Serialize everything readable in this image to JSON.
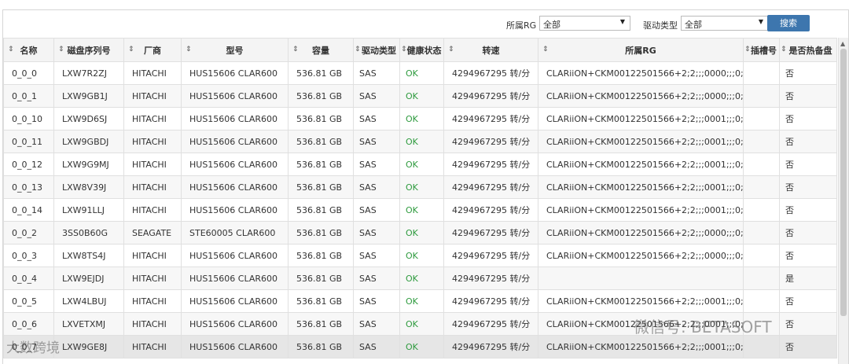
{
  "filters": {
    "rg_label": "所属RG",
    "rg_value": "全部",
    "drive_label": "驱动类型",
    "drive_value": "全部",
    "search_label": "搜索"
  },
  "icons": {
    "sort": "sort-icon",
    "dropdown": "triangle-down-icon",
    "scroll_up": "triangle-up-icon"
  },
  "colors": {
    "ok": "#2f9b3f",
    "button": "#3d76ae"
  },
  "columns": [
    "名称",
    "磁盘序列号",
    "厂商",
    "型号",
    "容量",
    "驱动类型",
    "健康状态",
    "转速",
    "所属RG",
    "插槽号",
    "是否热备盘"
  ],
  "rows": [
    {
      "name": "0_0_0",
      "serial": "LXW7R2ZJ",
      "vendor": "HITACHI",
      "model": "HUS15606 CLAR600",
      "capacity": "536.81 GB",
      "drive": "SAS",
      "health": "OK",
      "speed": "4294967295 转/分",
      "rg": "CLARiiON+CKM00122501566+2;2;;;0000;;;0;;",
      "slot": "",
      "hotspare": "否"
    },
    {
      "name": "0_0_1",
      "serial": "LXW9GB1J",
      "vendor": "HITACHI",
      "model": "HUS15606 CLAR600",
      "capacity": "536.81 GB",
      "drive": "SAS",
      "health": "OK",
      "speed": "4294967295 转/分",
      "rg": "CLARiiON+CKM00122501566+2;2;;;0000;;;0;;",
      "slot": "",
      "hotspare": "否"
    },
    {
      "name": "0_0_10",
      "serial": "LXW9D6SJ",
      "vendor": "HITACHI",
      "model": "HUS15606 CLAR600",
      "capacity": "536.81 GB",
      "drive": "SAS",
      "health": "OK",
      "speed": "4294967295 转/分",
      "rg": "CLARiiON+CKM00122501566+2;2;;;0001;;;0;;",
      "slot": "",
      "hotspare": "否"
    },
    {
      "name": "0_0_11",
      "serial": "LXW9GBDJ",
      "vendor": "HITACHI",
      "model": "HUS15606 CLAR600",
      "capacity": "536.81 GB",
      "drive": "SAS",
      "health": "OK",
      "speed": "4294967295 转/分",
      "rg": "CLARiiON+CKM00122501566+2;2;;;0001;;;0;;",
      "slot": "",
      "hotspare": "否"
    },
    {
      "name": "0_0_12",
      "serial": "LXW9G9MJ",
      "vendor": "HITACHI",
      "model": "HUS15606 CLAR600",
      "capacity": "536.81 GB",
      "drive": "SAS",
      "health": "OK",
      "speed": "4294967295 转/分",
      "rg": "CLARiiON+CKM00122501566+2;2;;;0001;;;0;;",
      "slot": "",
      "hotspare": "否"
    },
    {
      "name": "0_0_13",
      "serial": "LXW8V39J",
      "vendor": "HITACHI",
      "model": "HUS15606 CLAR600",
      "capacity": "536.81 GB",
      "drive": "SAS",
      "health": "OK",
      "speed": "4294967295 转/分",
      "rg": "CLARiiON+CKM00122501566+2;2;;;0001;;;0;;",
      "slot": "",
      "hotspare": "否"
    },
    {
      "name": "0_0_14",
      "serial": "LXW91LLJ",
      "vendor": "HITACHI",
      "model": "HUS15606 CLAR600",
      "capacity": "536.81 GB",
      "drive": "SAS",
      "health": "OK",
      "speed": "4294967295 转/分",
      "rg": "CLARiiON+CKM00122501566+2;2;;;0001;;;0;;",
      "slot": "",
      "hotspare": "否"
    },
    {
      "name": "0_0_2",
      "serial": "3SS0B60G",
      "vendor": "SEAGATE",
      "model": "STE60005 CLAR600",
      "capacity": "536.81 GB",
      "drive": "SAS",
      "health": "OK",
      "speed": "4294967295 转/分",
      "rg": "CLARiiON+CKM00122501566+2;2;;;0000;;;0;;",
      "slot": "",
      "hotspare": "否"
    },
    {
      "name": "0_0_3",
      "serial": "LXW8TS4J",
      "vendor": "HITACHI",
      "model": "HUS15606 CLAR600",
      "capacity": "536.81 GB",
      "drive": "SAS",
      "health": "OK",
      "speed": "4294967295 转/分",
      "rg": "CLARiiON+CKM00122501566+2;2;;;0000;;;0;;",
      "slot": "",
      "hotspare": "否"
    },
    {
      "name": "0_0_4",
      "serial": "LXW9EJDJ",
      "vendor": "HITACHI",
      "model": "HUS15606 CLAR600",
      "capacity": "536.81 GB",
      "drive": "SAS",
      "health": "OK",
      "speed": "4294967295 转/分",
      "rg": "",
      "slot": "",
      "hotspare": "是"
    },
    {
      "name": "0_0_5",
      "serial": "LXW4LBUJ",
      "vendor": "HITACHI",
      "model": "HUS15606 CLAR600",
      "capacity": "536.81 GB",
      "drive": "SAS",
      "health": "OK",
      "speed": "4294967295 转/分",
      "rg": "CLARiiON+CKM00122501566+2;2;;;0001;;;0;;",
      "slot": "",
      "hotspare": "否"
    },
    {
      "name": "0_0_6",
      "serial": "LXVETXMJ",
      "vendor": "HITACHI",
      "model": "HUS15606 CLAR600",
      "capacity": "536.81 GB",
      "drive": "SAS",
      "health": "OK",
      "speed": "4294967295 转/分",
      "rg": "CLARiiON+CKM00122501566+2;2;;;0001;;;0;;",
      "slot": "",
      "hotspare": "否"
    },
    {
      "name": "0_0_7",
      "serial": "LXW9GE8J",
      "vendor": "HITACHI",
      "model": "HUS15606 CLAR600",
      "capacity": "536.81 GB",
      "drive": "SAS",
      "health": "OK",
      "speed": "4294967295 转/分",
      "rg": "CLARiiON+CKM00122501566+2;2;;;0001;;;0;;",
      "slot": "",
      "hotspare": "否"
    }
  ],
  "watermarks": {
    "left": "大数跨境",
    "right": "微信号: BETASOFT"
  }
}
